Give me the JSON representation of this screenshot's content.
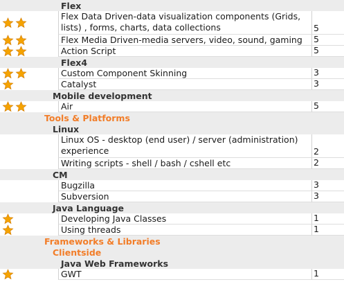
{
  "colors": {
    "section_orange": "#f27d28",
    "star_fill": "#f5a300",
    "star_stroke": "#d07a00",
    "header_gray": "#ececec"
  },
  "rows": [
    {
      "type": "subheader",
      "label": "Flex"
    },
    {
      "type": "item",
      "stars": 2,
      "name": "Flex Data Driven-data visualization components (Grids, lists) , forms, charts, data collections",
      "score": "5"
    },
    {
      "type": "item",
      "stars": 2,
      "name": "Flex Media Driven-media servers, video, sound, gaming",
      "score": "5"
    },
    {
      "type": "item",
      "stars": 2,
      "name": "Action Script",
      "score": "5"
    },
    {
      "type": "subheader",
      "label": "Flex4"
    },
    {
      "type": "item",
      "stars": 2,
      "name": "Custom Component Skinning",
      "score": "3"
    },
    {
      "type": "item",
      "stars": 1,
      "name": "Catalyst",
      "score": "3"
    },
    {
      "type": "subheader",
      "label": "Mobile development"
    },
    {
      "type": "item",
      "stars": 2,
      "name": "Air",
      "score": "5"
    },
    {
      "type": "section",
      "label": "Tools & Platforms"
    },
    {
      "type": "subheader",
      "label": "Linux"
    },
    {
      "type": "item",
      "stars": 0,
      "name": "Linux OS - desktop (end user) / server (administration) experience",
      "score": "2"
    },
    {
      "type": "item",
      "stars": 0,
      "name": "Writing scripts - shell / bash / cshell etc",
      "score": "2"
    },
    {
      "type": "subheader",
      "label": "CM"
    },
    {
      "type": "item",
      "stars": 0,
      "name": "Bugzilla",
      "score": "3"
    },
    {
      "type": "item",
      "stars": 0,
      "name": "Subversion",
      "score": "3"
    },
    {
      "type": "subheader",
      "label": "Java Language"
    },
    {
      "type": "item",
      "stars": 1,
      "name": "Developing Java Classes",
      "score": "1"
    },
    {
      "type": "item",
      "stars": 1,
      "name": "Using threads",
      "score": "1"
    },
    {
      "type": "section",
      "label": "Frameworks & Libraries"
    },
    {
      "type": "section",
      "label": "Clientside"
    },
    {
      "type": "subheader",
      "label": "Java Web Frameworks"
    },
    {
      "type": "item",
      "stars": 1,
      "name": "GWT",
      "score": "1"
    }
  ]
}
